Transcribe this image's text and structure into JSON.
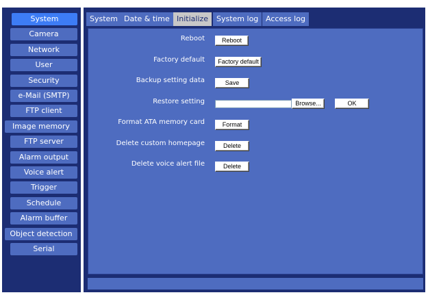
{
  "sidebar": {
    "items": [
      {
        "label": "System"
      },
      {
        "label": "Camera"
      },
      {
        "label": "Network"
      },
      {
        "label": "User"
      },
      {
        "label": "Security"
      },
      {
        "label": "e-Mail (SMTP)"
      },
      {
        "label": "FTP client"
      },
      {
        "label": "Image memory"
      },
      {
        "label": "FTP server"
      },
      {
        "label": "Alarm output"
      },
      {
        "label": "Voice alert"
      },
      {
        "label": "Trigger"
      },
      {
        "label": "Schedule"
      },
      {
        "label": "Alarm buffer"
      },
      {
        "label": "Object detection"
      },
      {
        "label": "Serial"
      }
    ],
    "active": "System"
  },
  "tabs": [
    {
      "label": "System"
    },
    {
      "label": "Date & time"
    },
    {
      "label": "Initialize"
    },
    {
      "label": "System log"
    },
    {
      "label": "Access log"
    }
  ],
  "active_tab": "Initialize",
  "rows": {
    "reboot": {
      "label": "Reboot",
      "button": "Reboot"
    },
    "factory_default": {
      "label": "Factory default",
      "button": "Factory default"
    },
    "backup": {
      "label": "Backup setting data",
      "button": "Save"
    },
    "restore": {
      "label": "Restore setting",
      "input_value": "",
      "browse": "Browse...",
      "ok": "OK"
    },
    "format_ata": {
      "label": "Format ATA memory card",
      "button": "Format"
    },
    "delete_homepage": {
      "label": "Delete custom homepage",
      "button": "Delete"
    },
    "delete_voice": {
      "label": "Delete voice alert file",
      "button": "Delete"
    }
  },
  "colors": {
    "background": "#1c2d73",
    "panel": "#4e6cc0",
    "active_menu": "#3d7cf5",
    "active_tab": "#c8c8c8"
  }
}
